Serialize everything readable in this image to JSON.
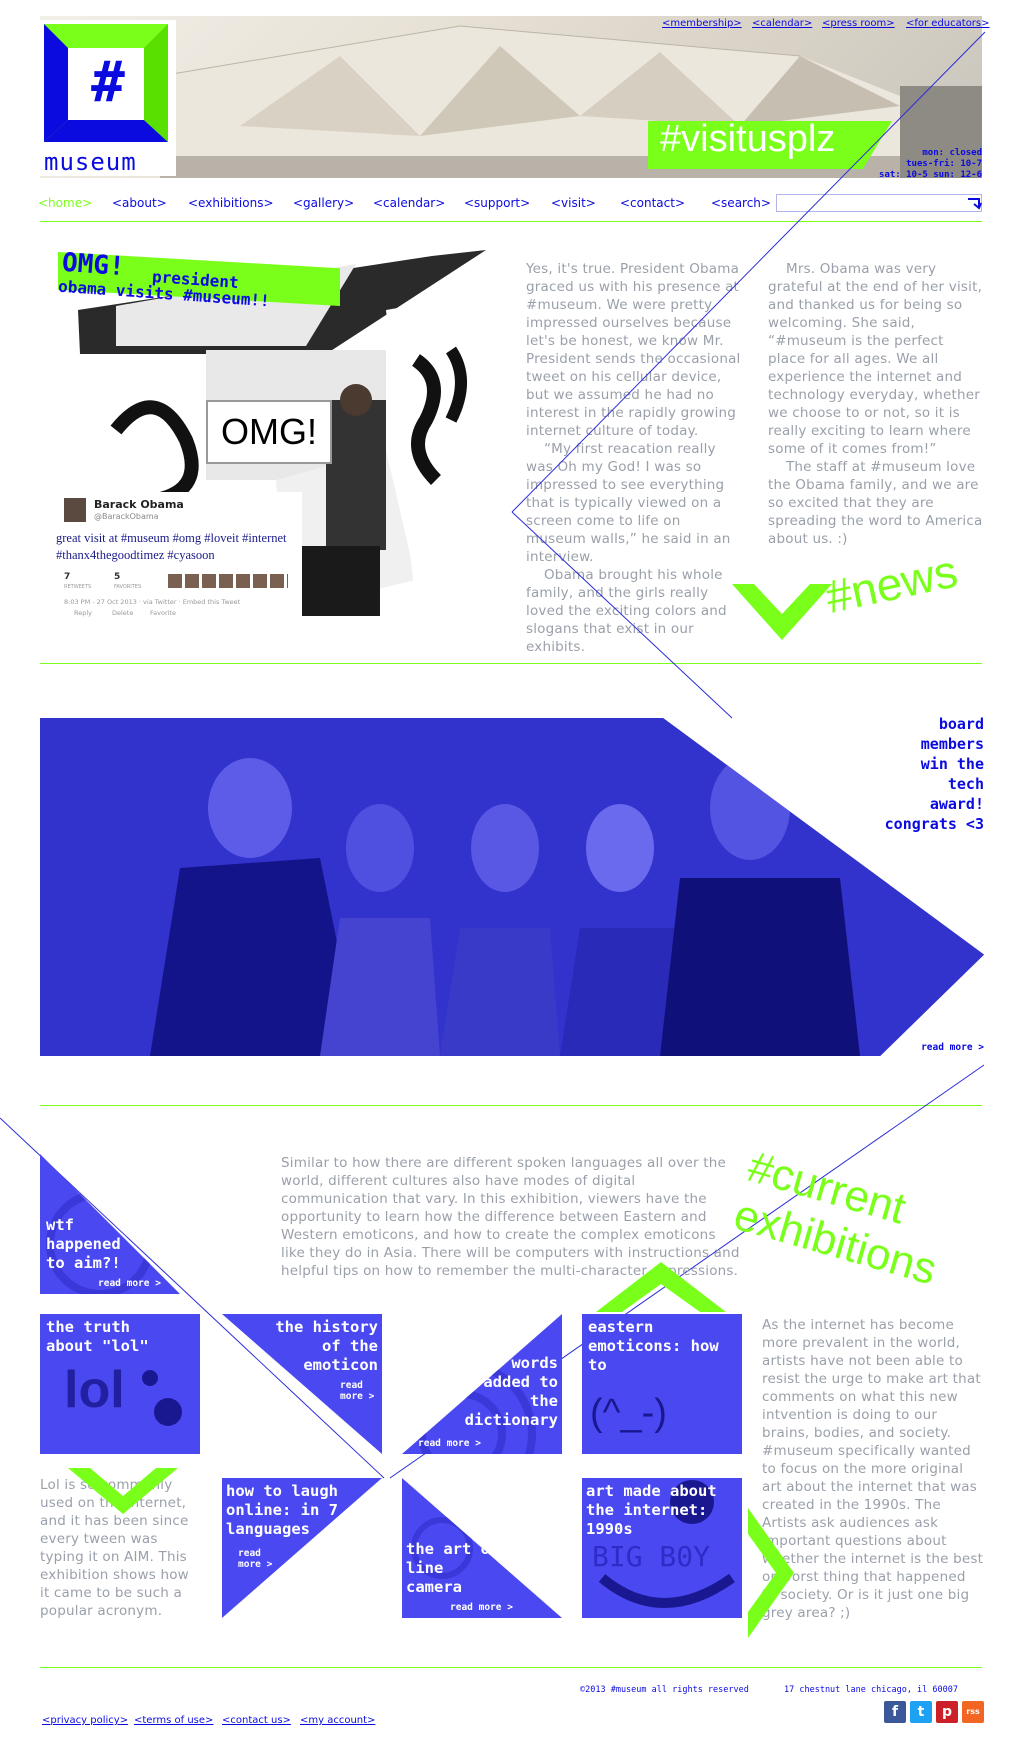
{
  "top_links": [
    "<membership>",
    "<calendar>",
    "<press room>",
    "<for educators>"
  ],
  "logo": {
    "symbol": "#",
    "name": "museum"
  },
  "hero": {
    "hashtag": "#visitusplz",
    "hours": [
      "mon: closed",
      "tues-fri: 10-7",
      "sat: 10-5 sun: 12-6"
    ]
  },
  "nav": [
    "<home>",
    "<about>",
    "<exhibitions>",
    "<gallery>",
    "<calendar>",
    "<support>",
    "<visit>",
    "<contact>",
    "<search>"
  ],
  "search": {
    "placeholder": ""
  },
  "news": {
    "headline_1": "OMG!",
    "headline_2": "president",
    "headline_3": "obama visits #museum!!",
    "omg_sign": "OMG!",
    "tweet": {
      "name": "Barack Obama",
      "handle": "@BarackObama",
      "text": "great visit at #museum #omg #loveit #internet #thanx4thegoodtimez #cyasoon",
      "retweets_count": "7",
      "retweets_label": "RETWEETS",
      "favorites_count": "5",
      "favorites_label": "FAVORITES",
      "meta": "8:03 PM - 27 Oct 2013 · via Twitter · Embed this Tweet",
      "reply": "Reply",
      "delete": "Delete",
      "favorite": "Favorite"
    },
    "col1": "Yes, it's true. President Obama graced us with his presence at #museum. We were pretty impressed ourselves because let's be honest, we know Mr. President sends the occasional tweet on his cellular device, but we assumed he had no interest in the rapidly growing internet culture of today.\n    “My first reacation really was Oh my God! I was so impressed to see everything that is typically viewed on a screen come to life on museum walls,” he said in an interview.\n    Obama brought his whole family, and the girls really loved the exciting colors and slogans that exist in our exhibits.",
    "col2": "    Mrs. Obama was very grateful at the end of her visit, and thanked us for being so welcoming. She said, “#museum is the perfect place for all ages. We all experience the internet and technology everyday, whether we choose to or not, so it is really exciting to learn where some of it comes from!”\n    The staff at #museum love the Obama family, and we are so excited that they are spreading the word to America about us. :)",
    "tag": "#news"
  },
  "board": {
    "caption": [
      "board",
      "members",
      "win the",
      "tech",
      "award!",
      "congrats <3"
    ],
    "read_more": "read more >"
  },
  "exhibitions": {
    "tag_1": "#current",
    "tag_2": "exhibitions",
    "intro": "Similar to how there are different spoken languages all over the world, different cultures also have modes of digital communication that vary. In this exhibition, viewers have the opportunity to learn how the difference between Eastern and Western emoticons, and how to create the complex emoticons like they do in Asia. There will be computers with instructions and helpful tips on how to remember the multi-character expressions.",
    "right_text": "As the internet has become more prevalent in the world, artists have not been able to resist the urge to make art that comments on what this new intvention is doing to our brains, bodies, and society. #museum specifically wanted to focus on the more original art about the internet that was created in the 1990s. The Artists ask audiences ask important questions about whether the internet is the best or worst thing that happened to society. Or is it just one big grey area? ;)",
    "left_text": "Lol is so commonly used on the internet, and it has been since every tween was typing it on AIM. This exhibition shows how it came to be such a popular acronym.",
    "tiles": {
      "aim": "wtf happened to aim?!",
      "aim_more": "read more >",
      "lol": "the truth about \"lol\"",
      "lol_art": "lol",
      "history": "the history of the emoticon",
      "history_more": "read more >",
      "words": "words added to the dictionary",
      "words_more": "read more >",
      "eastern": "eastern emoticons: how to",
      "eastern_art": "(^_-)",
      "laugh": "how to laugh online: in 7 languages",
      "laugh_more": "read more >",
      "line": "the art of line camera",
      "line_more": "read more >",
      "art90": "art made about the internet: 1990s",
      "art90_art": "BIG B0Y"
    }
  },
  "footer": {
    "copyright": "©2013 #museum all rights reserved",
    "address": "17 chestnut lane chicago, il 60007",
    "links": [
      "<privacy policy>",
      "<terms of use>",
      "<contact us>",
      "<my account>"
    ],
    "social": [
      "f",
      "t",
      "p",
      "rss"
    ]
  },
  "colors": {
    "accent_green": "#7aff1a",
    "accent_blue": "#1a1acc",
    "tile_blue": "#4a48f0"
  }
}
